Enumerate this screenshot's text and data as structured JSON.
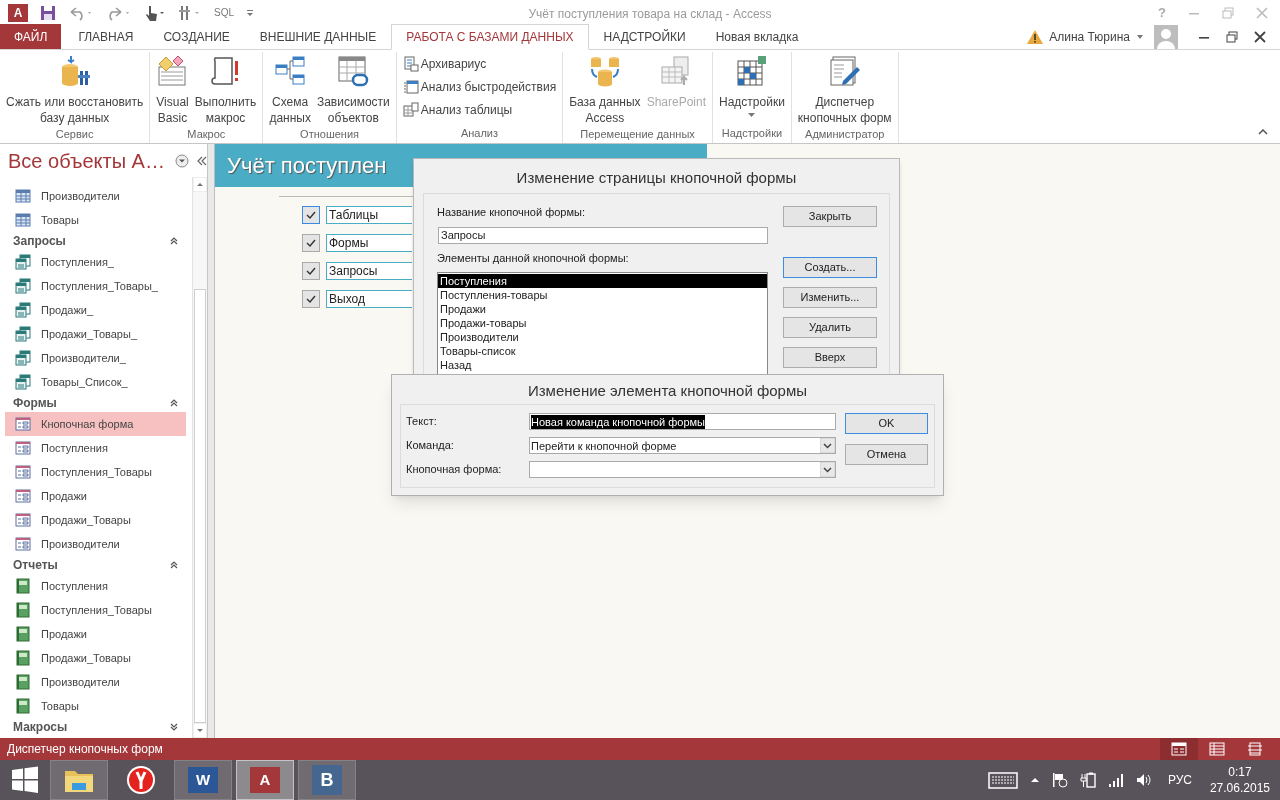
{
  "title_bar": {
    "app_letter": "A",
    "sql": "SQL",
    "title": "Учёт поступления товара на склад - Access",
    "help": "?"
  },
  "tabs": [
    {
      "label": "ФАЙЛ",
      "kind": "file",
      "selected": false
    },
    {
      "label": "ГЛАВНАЯ",
      "kind": "tab",
      "selected": false
    },
    {
      "label": "СОЗДАНИЕ",
      "kind": "tab",
      "selected": false
    },
    {
      "label": "ВНЕШНИЕ ДАННЫЕ",
      "kind": "tab",
      "selected": false
    },
    {
      "label": "РАБОТА С БАЗАМИ ДАННЫХ",
      "kind": "tab",
      "selected": true
    },
    {
      "label": "НАДСТРОЙКИ",
      "kind": "tab",
      "selected": false
    },
    {
      "label": "Новая вкладка",
      "kind": "tab",
      "selected": false
    }
  ],
  "account": {
    "name": "Алина Тюрина"
  },
  "ribbon": {
    "groups": [
      {
        "label": "Сервис",
        "buttons": [
          {
            "label": "Сжать или восстановить\nбазу данных",
            "kind": "large",
            "disabled": false,
            "menu": false
          }
        ]
      },
      {
        "label": "Макрос",
        "buttons": [
          {
            "label": "Visual\nBasic",
            "kind": "large",
            "disabled": false,
            "menu": false
          },
          {
            "label": "Выполнить\nмакрос",
            "kind": "large",
            "disabled": false,
            "menu": false
          }
        ]
      },
      {
        "label": "Отношения",
        "buttons": [
          {
            "label": "Схема\nданных",
            "kind": "large",
            "disabled": false,
            "menu": false
          },
          {
            "label": "Зависимости\nобъектов",
            "kind": "large",
            "disabled": false,
            "menu": false
          }
        ]
      },
      {
        "label": "Анализ",
        "buttons": [
          {
            "label": "Архивариус",
            "kind": "small",
            "disabled": false,
            "menu": false
          },
          {
            "label": "Анализ быстродействия",
            "kind": "small",
            "disabled": false,
            "menu": false
          },
          {
            "label": "Анализ таблицы",
            "kind": "small",
            "disabled": false,
            "menu": false
          }
        ]
      },
      {
        "label": "Перемещение данных",
        "buttons": [
          {
            "label": "База данных\nAccess",
            "kind": "large",
            "disabled": false,
            "menu": false
          },
          {
            "label": "SharePoint",
            "kind": "large",
            "disabled": true,
            "menu": false
          }
        ]
      },
      {
        "label": "Надстройки",
        "buttons": [
          {
            "label": "Надстройки",
            "kind": "large",
            "disabled": false,
            "menu": true
          }
        ]
      },
      {
        "label": "Администратор",
        "buttons": [
          {
            "label": "Диспетчер\nкнопочных форм",
            "kind": "large",
            "disabled": false,
            "menu": false
          }
        ]
      }
    ]
  },
  "nav": {
    "title": "Все объекты A…",
    "groups": [
      {
        "kind": "table",
        "items": [
          {
            "label": "Производители",
            "selected": false
          },
          {
            "label": "Товары",
            "selected": false
          }
        ]
      },
      {
        "label": "Запросы",
        "kind": "query",
        "expanded": true,
        "items": [
          {
            "label": "Поступления_",
            "selected": false
          },
          {
            "label": "Поступления_Товары_",
            "selected": false
          },
          {
            "label": "Продажи_",
            "selected": false
          },
          {
            "label": "Продажи_Товары_",
            "selected": false
          },
          {
            "label": "Производители_",
            "selected": false
          },
          {
            "label": "Товары_Список_",
            "selected": false
          }
        ]
      },
      {
        "label": "Формы",
        "kind": "form",
        "expanded": true,
        "items": [
          {
            "label": "Кнопочная форма",
            "selected": true
          },
          {
            "label": "Поступления",
            "selected": false
          },
          {
            "label": "Поступления_Товары",
            "selected": false
          },
          {
            "label": "Продажи",
            "selected": false
          },
          {
            "label": "Продажи_Товары",
            "selected": false
          },
          {
            "label": "Производители",
            "selected": false
          }
        ]
      },
      {
        "label": "Отчеты",
        "kind": "report",
        "expanded": true,
        "items": [
          {
            "label": "Поступления",
            "selected": false
          },
          {
            "label": "Поступления_Товары",
            "selected": false
          },
          {
            "label": "Продажи",
            "selected": false
          },
          {
            "label": "Продажи_Товары",
            "selected": false
          },
          {
            "label": "Производители",
            "selected": false
          },
          {
            "label": "Товары",
            "selected": false
          }
        ]
      },
      {
        "label": "Макросы",
        "expanded": false
      }
    ]
  },
  "form": {
    "title": "Учёт поступлен",
    "buttons": [
      {
        "label": "Таблицы",
        "focused": true
      },
      {
        "label": "Формы",
        "focused": false
      },
      {
        "label": "Запросы",
        "focused": false
      },
      {
        "label": "Выход",
        "focused": false
      }
    ]
  },
  "page_dialog": {
    "title": "Изменение страницы кнопочной формы",
    "name_label": "Название кнопочной формы:",
    "name_value": "Запросы",
    "items_label": "Элементы данной кнопочной формы:",
    "items": [
      {
        "label": "Поступления",
        "selected": true
      },
      {
        "label": "Поступления-товары",
        "selected": false
      },
      {
        "label": "Продажи",
        "selected": false
      },
      {
        "label": "Продажи-товары",
        "selected": false
      },
      {
        "label": "Производители",
        "selected": false
      },
      {
        "label": "Товары-список",
        "selected": false
      },
      {
        "label": "Назад",
        "selected": false
      }
    ],
    "buttons": [
      {
        "label": "Закрыть",
        "focused": false
      },
      {
        "label": "Создать...",
        "focused": true
      },
      {
        "label": "Изменить...",
        "focused": false
      },
      {
        "label": "Удалить",
        "focused": false
      },
      {
        "label": "Вверх",
        "focused": false
      }
    ]
  },
  "item_dialog": {
    "title": "Изменение элемента кнопочной формы",
    "fields": [
      {
        "label": "Текст:",
        "kind": "text",
        "value": "Новая команда кнопочной формы",
        "selected": true
      },
      {
        "label": "Команда:",
        "kind": "combo",
        "value": "Перейти к кнопочной форме",
        "selected": false
      },
      {
        "label": "Кнопочная форма:",
        "kind": "combo",
        "selected": false
      }
    ],
    "buttons": [
      {
        "label": "OK",
        "focused": true
      },
      {
        "label": "Отмена",
        "focused": false
      }
    ]
  },
  "status_bar": {
    "text": "Диспетчер кнопочных форм",
    "views": [
      {
        "selected": true
      },
      {
        "selected": false
      },
      {
        "selected": false
      }
    ]
  },
  "taskbar": {
    "apps": [
      {
        "kind": "explorer",
        "running": true,
        "selected": false
      },
      {
        "kind": "browser",
        "running": false,
        "selected": false
      },
      {
        "kind": "word",
        "letter": "W",
        "running": true,
        "selected": false
      },
      {
        "kind": "access",
        "letter": "A",
        "running": true,
        "selected": true
      },
      {
        "kind": "social",
        "letter": "В",
        "running": true,
        "selected": false
      }
    ],
    "language": "РУС",
    "time": "0:17",
    "date": "27.06.2015"
  }
}
